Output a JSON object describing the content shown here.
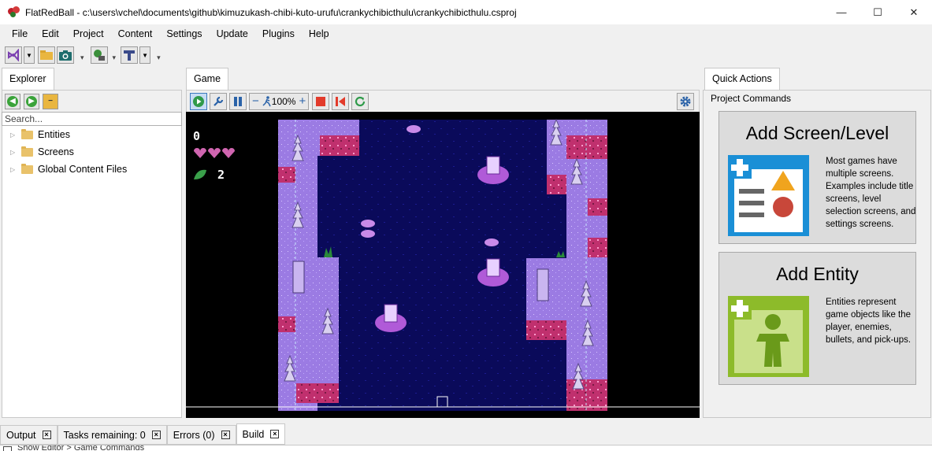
{
  "window": {
    "title": "FlatRedBall - c:\\users\\vchel\\documents\\github\\kimuzukash-chibi-kuto-urufu\\crankychibicthulu\\crankychibicthulu.csproj",
    "minimize": "—",
    "maximize": "☐",
    "close": "✕"
  },
  "menu": [
    "File",
    "Edit",
    "Project",
    "Content",
    "Settings",
    "Update",
    "Plugins",
    "Help"
  ],
  "explorer": {
    "tab": "Explorer",
    "search_placeholder": "Search...",
    "items": [
      "Entities",
      "Screens",
      "Global Content Files"
    ]
  },
  "game": {
    "tab": "Game",
    "zoom": "100%",
    "hud_score": "0",
    "hud_lives": "2"
  },
  "quick_actions": {
    "tab": "Quick Actions",
    "group": "Project Commands",
    "cards": [
      {
        "title": "Add Screen/Level",
        "desc": "Most games have multiple screens. Examples include title screens, level selection screens, and settings screens."
      },
      {
        "title": "Add Entity",
        "desc": "Entities represent game objects like the player, enemies, bullets, and pick-ups."
      }
    ]
  },
  "bottom_tabs": [
    "Output",
    "Tasks remaining: 0",
    "Errors (0)",
    "Build"
  ],
  "status": "Show Editor > Game Commands",
  "colors": {
    "accent_blue": "#1a8fd6",
    "accent_green": "#8dbb2a",
    "water": "#0a0a5a",
    "land": "#9b7be3"
  }
}
